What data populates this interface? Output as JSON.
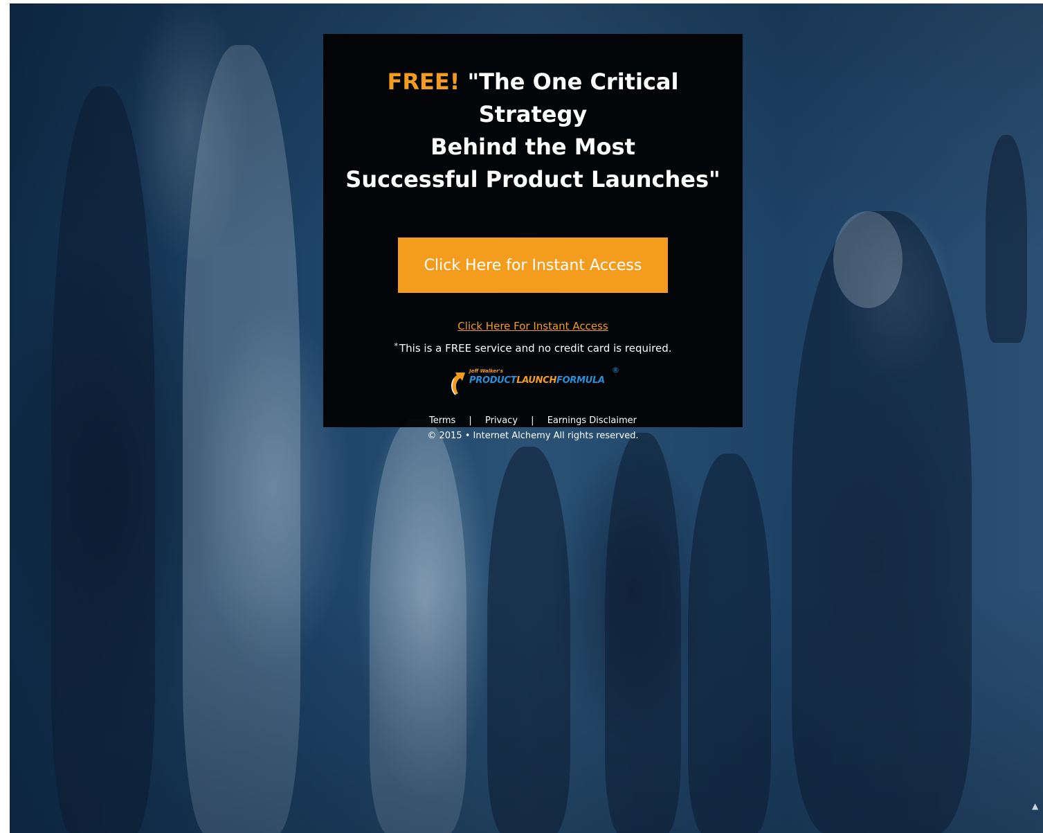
{
  "hero": {
    "headline_free": "FREE!",
    "headline_line1": "\"The One Critical Strategy",
    "headline_line2": "Behind the Most",
    "headline_line3": "Successful Product Launches\"",
    "cta_button_label": "Click Here for Instant Access",
    "cta_link_label": "Click Here For Instant Access",
    "note_asterisk": "*",
    "note_text": "This is a FREE service and no credit card is required."
  },
  "logo": {
    "small_text": "Jeff Walker's",
    "word1": "PRODUCT",
    "word2": "LAUNCH",
    "word3": "FORMULA",
    "registered": "®"
  },
  "footer": {
    "terms": "Terms",
    "privacy": "Privacy",
    "earnings": "Earnings Disclaimer",
    "separator": "|",
    "copyright": "© 2015 • Internet Alchemy  All rights reserved."
  },
  "colors": {
    "accent": "#f39c1e",
    "panel_bg": "#000000",
    "background_tint": "#1e4468",
    "logo_blue": "#2a8fd8"
  }
}
